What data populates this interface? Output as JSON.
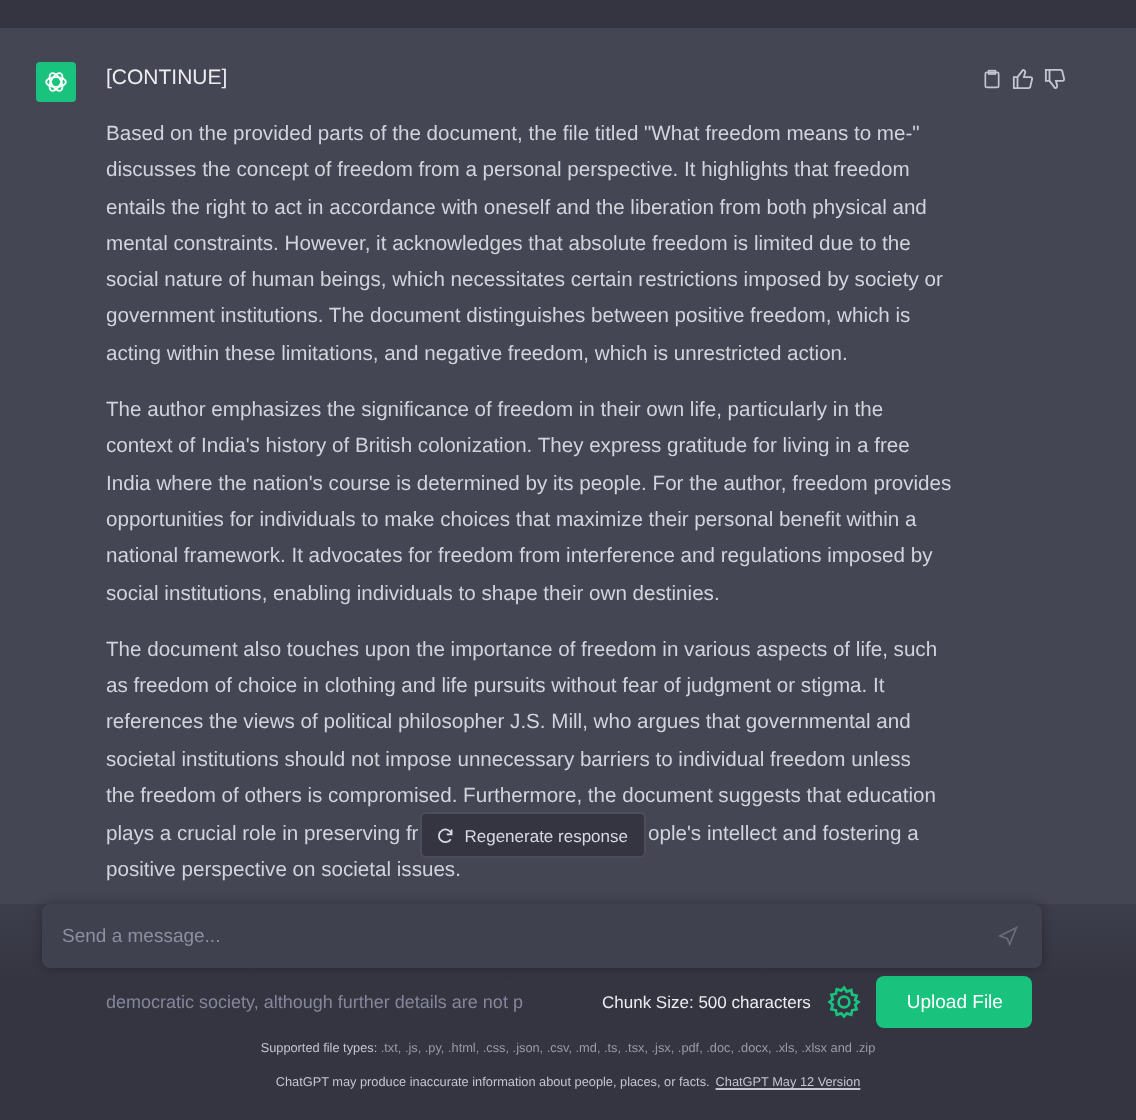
{
  "message": {
    "title": "[CONTINUE]",
    "paragraphs": [
      {
        "lines": [
          "Based on the provided parts of the document, the file titled \"What freedom means to me-\"",
          "discusses the concept of freedom from a personal perspective. It highlights that freedom",
          "entails the right to act in accordance with oneself and the liberation from both physical and",
          "mental constraints. However, it acknowledges that absolute freedom is limited due to the",
          "social nature of human beings, which necessitates certain restrictions imposed by society or",
          "government institutions. The document distinguishes between positive freedom, which is",
          "acting within these limitations, and negative freedom, which is unrestricted action."
        ]
      },
      {
        "lines": [
          "The author emphasizes the significance of freedom in their own life, particularly in the",
          "context of India's history of British colonization. They express gratitude for living in a free",
          "India where the nation's course is determined by its people. For the author, freedom provides",
          "opportunities for individuals to make choices that maximize their personal benefit within a",
          "national framework. It advocates for freedom from interference and regulations imposed by",
          "social institutions, enabling individuals to shape their own destinies."
        ]
      },
      {
        "lines": [
          "The document also touches upon the importance of freedom in various aspects of life, such",
          "as freedom of choice in clothing and life pursuits without fear of judgment or stigma. It",
          "references the views of political philosopher J.S. Mill, who argues that governmental and",
          "societal institutions should not impose unnecessary barriers to individual freedom unless",
          "the freedom of others is compromised. Furthermore, the document suggests that education"
        ]
      }
    ],
    "covered_line": {
      "before": "plays a crucial role in preserving fr",
      "after": "ople's intellect and fostering a"
    },
    "last_line": "positive perspective on societal issues.",
    "faded_line": "democratic society, although further details are not p"
  },
  "regenerate_button": "Regenerate response",
  "input": {
    "placeholder": "Send a message..."
  },
  "chunk_size": "Chunk Size: 500 characters",
  "upload_button": "Upload File",
  "supported": {
    "label": "Supported file types:",
    "types": ".txt, .js, .py, .html, .css, .json, .csv, .md, .ts, .tsx, .jsx, .pdf, .doc, .docx, .xls, .xlsx and .zip"
  },
  "disclaimer": {
    "text": "ChatGPT may produce inaccurate information about people, places, or facts.",
    "link": "ChatGPT May 12 Version"
  }
}
